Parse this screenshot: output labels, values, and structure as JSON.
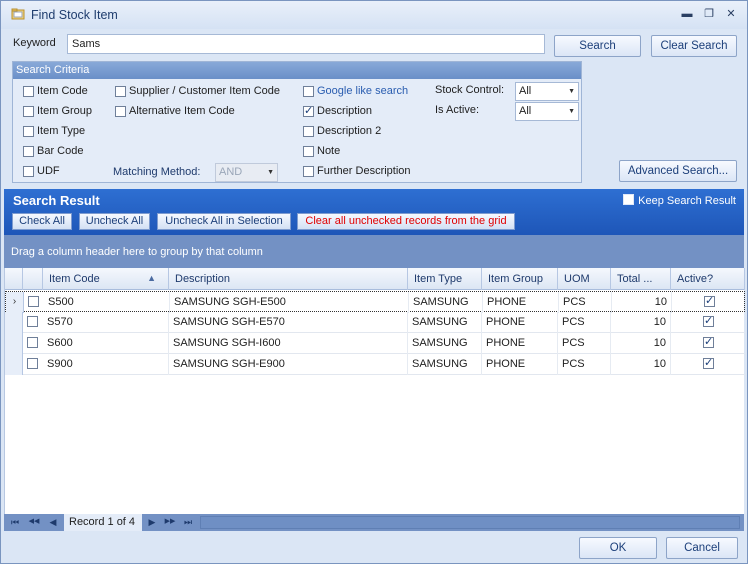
{
  "window": {
    "title": "Find Stock Item",
    "minimize": "▬",
    "maximize": "❐",
    "close": "✕"
  },
  "keyword": {
    "label": "Keyword",
    "value": "Sams"
  },
  "buttons": {
    "search": "Search",
    "clear_search": "Clear Search",
    "advanced_search": "Advanced Search...",
    "ok": "OK",
    "cancel": "Cancel"
  },
  "criteria": {
    "title": "Search Criteria",
    "options": [
      {
        "label": "Item Code",
        "checked": false
      },
      {
        "label": "Item Group",
        "checked": false
      },
      {
        "label": "Item Type",
        "checked": false
      },
      {
        "label": "Bar Code",
        "checked": false
      },
      {
        "label": "UDF",
        "checked": false
      },
      {
        "label": "Supplier / Customer Item Code",
        "checked": false
      },
      {
        "label": "Alternative Item Code",
        "checked": false
      },
      {
        "label": "Google like search",
        "checked": false
      },
      {
        "label": "Description",
        "checked": true
      },
      {
        "label": "Description 2",
        "checked": false
      },
      {
        "label": "Note",
        "checked": false
      },
      {
        "label": "Further Description",
        "checked": false
      }
    ],
    "matching_method": {
      "label": "Matching Method:",
      "value": "AND"
    },
    "stock_control": {
      "label": "Stock Control:",
      "value": "All"
    },
    "is_active": {
      "label": "Is Active:",
      "value": "All"
    }
  },
  "result": {
    "title": "Search Result",
    "keep_label": "Keep Search Result",
    "check_all": "Check All",
    "uncheck_all": "Uncheck All",
    "uncheck_all_selection": "Uncheck All in Selection",
    "clear_unchecked": "Clear all unchecked records from the grid",
    "group_hint": "Drag a column header here to group by that column"
  },
  "grid": {
    "columns": [
      "Item Code",
      "Description",
      "Item Type",
      "Item Group",
      "UOM",
      "Total ...",
      "Active?"
    ],
    "sort_indicator": "▲",
    "rows": [
      {
        "code": "S500",
        "description": "SAMSUNG SGH-E500",
        "type": "SAMSUNG",
        "group": "PHONE",
        "uom": "PCS",
        "total": "10",
        "active": true
      },
      {
        "code": "S570",
        "description": "SAMSUNG SGH-E570",
        "type": "SAMSUNG",
        "group": "PHONE",
        "uom": "PCS",
        "total": "10",
        "active": true
      },
      {
        "code": "S600",
        "description": "SAMSUNG SGH-I600",
        "type": "SAMSUNG",
        "group": "PHONE",
        "uom": "PCS",
        "total": "10",
        "active": true
      },
      {
        "code": "S900",
        "description": "SAMSUNG SGH-E900",
        "type": "SAMSUNG",
        "group": "PHONE",
        "uom": "PCS",
        "total": "10",
        "active": true
      }
    ]
  },
  "navigator": {
    "record_text": "Record 1 of 4",
    "first": "⏮",
    "prev_page": "◀◀",
    "prev": "◀",
    "next": "▶",
    "next_page": "▶▶",
    "last": "⏭"
  },
  "colors": {
    "accent": "#1e56b8",
    "warning_text": "#e00000"
  }
}
